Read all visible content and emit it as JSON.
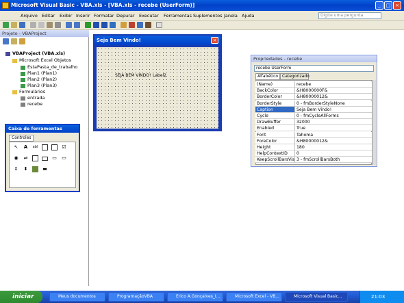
{
  "window": {
    "title": "Microsoft Visual Basic - VBA.xls - [VBA.xls - recebe (UserForm)]",
    "min": "_",
    "max": "□",
    "close": "×"
  },
  "menu": {
    "items": [
      "Arquivo",
      "Editar",
      "Exibir",
      "Inserir",
      "Formatar",
      "Depurar",
      "Executar",
      "Ferramentas",
      "Suplementos",
      "Janela",
      "Ajuda"
    ],
    "ask_placeholder": "Digite uma pergunta"
  },
  "project": {
    "title": "Projeto - VBAProject",
    "root": "VBAProject (VBA.xls)",
    "excel_folder": "Microsoft Excel Objetos",
    "sheets": [
      "EstaPasta_de_trabalho",
      "Plan1 (Plan1)",
      "Plan2 (Plan2)",
      "Plan3 (Plan3)"
    ],
    "forms_folder": "Formulários",
    "forms": [
      "entrada",
      "recebe"
    ]
  },
  "toolbox": {
    "title": "Caixa de ferramentas",
    "tab": "Controles"
  },
  "userform": {
    "caption": "Seja Bem Vindo!",
    "label1": "SEJA BEM VINDO!",
    "label2": "Label2"
  },
  "properties": {
    "title": "Propriedades - recebe",
    "object": "recebe UserForm",
    "tabs": [
      "Alfabético",
      "Categorizado"
    ],
    "rows": [
      {
        "name": "(Name)",
        "value": "recebe"
      },
      {
        "name": "BackColor",
        "value": "&H8000000F&"
      },
      {
        "name": "BorderColor",
        "value": "&H80000012&"
      },
      {
        "name": "BorderStyle",
        "value": "0 - fmBorderStyleNone"
      },
      {
        "name": "Caption",
        "value": "Seja Bem Vindo!"
      },
      {
        "name": "Cycle",
        "value": "0 - fmCycleAllForms"
      },
      {
        "name": "DrawBuffer",
        "value": "32000"
      },
      {
        "name": "Enabled",
        "value": "True"
      },
      {
        "name": "Font",
        "value": "Tahoma"
      },
      {
        "name": "ForeColor",
        "value": "&H80000012&"
      },
      {
        "name": "Height",
        "value": "180"
      },
      {
        "name": "HelpContextID",
        "value": "0"
      },
      {
        "name": "KeepScrollBarsVisible",
        "value": "3 - fmScrollBarsBoth"
      }
    ]
  },
  "taskbar": {
    "start": "iniciar",
    "buttons": [
      "Meus documentos",
      "ProgramaçãoVBA",
      "Erico A.Gonçalves_I...",
      "Microsoft Excel - VB...",
      "Microsoft Visual Basic..."
    ],
    "clock": "21:03"
  },
  "colors": {
    "accent": "#0a3fc8",
    "selection": "#316ac5",
    "chrome": "#ece9d8"
  }
}
